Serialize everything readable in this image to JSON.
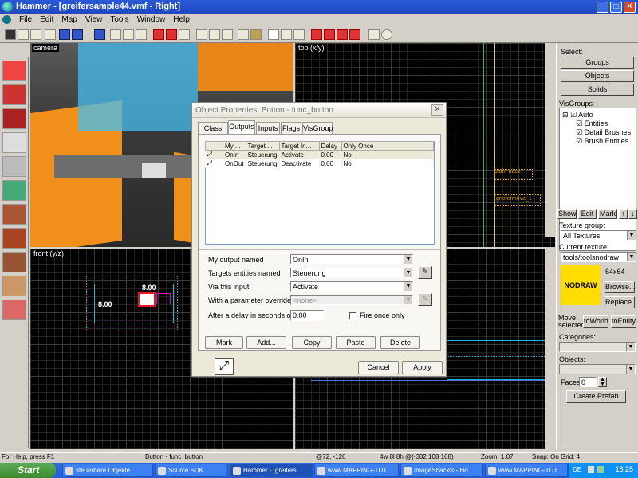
{
  "window": {
    "title": "Hammer - [greifersample44.vmf - Right]",
    "controls": {
      "minimize": "_",
      "maximize": "□",
      "close": "✕"
    }
  },
  "menu": [
    "File",
    "Edit",
    "Map",
    "View",
    "Tools",
    "Window",
    "Help"
  ],
  "viewports": {
    "camera": "camera",
    "top": "top (x/y)",
    "front": "front (y/z)",
    "front_labels": [
      "8.00",
      "8.00"
    ],
    "top_labels": [
      "path_track",
      "greifermove_1"
    ]
  },
  "right_panel": {
    "select_label": "Select:",
    "select_buttons": [
      "Groups",
      "Objects",
      "Solids"
    ],
    "visgroups_label": "VisGroups:",
    "visgroups": [
      {
        "label": "Auto",
        "checked": true,
        "level": 0
      },
      {
        "label": "Entities",
        "checked": true,
        "level": 1
      },
      {
        "label": "Detail Brushes",
        "checked": true,
        "level": 1
      },
      {
        "label": "Brush Entities",
        "checked": true,
        "level": 1
      }
    ],
    "vis_buttons": [
      "Show",
      "Edit",
      "Mark"
    ],
    "texture_group_label": "Texture group:",
    "texture_group": "All Textures",
    "current_texture_label": "Current texture:",
    "current_texture": "tools/toolsnodraw",
    "texture_preview": "NODRAW",
    "texture_size": "64x64",
    "browse": "Browse...",
    "replace": "Replace...",
    "move_selected_label": "Move selected:",
    "to_world": "toWorld",
    "to_entity": "toEntity",
    "categories_label": "Categories:",
    "objects_label": "Objects:",
    "faces_label": "Faces:",
    "faces_value": "0",
    "create_prefab": "Create Prefab",
    "colors": {
      "texture_preview_bg": "#ffdd00"
    }
  },
  "dialog": {
    "title": "Object Properties: Button - func_button",
    "tabs": [
      "Class Info",
      "Outputs",
      "Inputs",
      "Flags",
      "VisGroup"
    ],
    "active_tab": "Outputs",
    "columns": [
      "My ...",
      "Target ...",
      "Target In...",
      "Delay",
      "Only Once"
    ],
    "rows": [
      {
        "output": "OnIn",
        "target": "Steuerung",
        "input": "Activate",
        "delay": "0.00",
        "once": "No"
      },
      {
        "output": "OnOut",
        "target": "Steuerung",
        "input": "Deactivate",
        "delay": "0.00",
        "once": "No"
      }
    ],
    "my_output_label": "My output named",
    "my_output_value": "OnIn",
    "targets_label": "Targets entities named",
    "targets_value": "Steuerung",
    "via_input_label": "Via this input",
    "via_input_value": "Activate",
    "param_label": "With a parameter override of",
    "param_value": "<none>",
    "delay_label": "After a delay in seconds of",
    "delay_value": "0.00",
    "fire_once_label": "Fire once only",
    "buttons": [
      "Mark",
      "Add...",
      "Copy",
      "Paste",
      "Delete"
    ],
    "cancel": "Cancel",
    "apply": "Apply"
  },
  "status": {
    "help": "For Help, press F1",
    "selection": "Button - func_button",
    "coords": "@72, -126",
    "size": "4w 8l 8h @(-382 108 168)",
    "zoom": "Zoom: 1.07",
    "snap": "Snap: On Grid: 4"
  },
  "taskbar": {
    "start": "Start",
    "tasks": [
      {
        "label": "steuerbare Objekte...",
        "active": false
      },
      {
        "label": "Source SDK",
        "active": false
      },
      {
        "label": "Hammer - [greifers...",
        "active": true
      },
      {
        "label": "www.MAPPING-TUT...",
        "active": false
      },
      {
        "label": "ImageShack® - Ho...",
        "active": false
      },
      {
        "label": "www.MAPPING-TUT...",
        "active": false
      }
    ],
    "lang": "DE",
    "clock": "18:25"
  }
}
